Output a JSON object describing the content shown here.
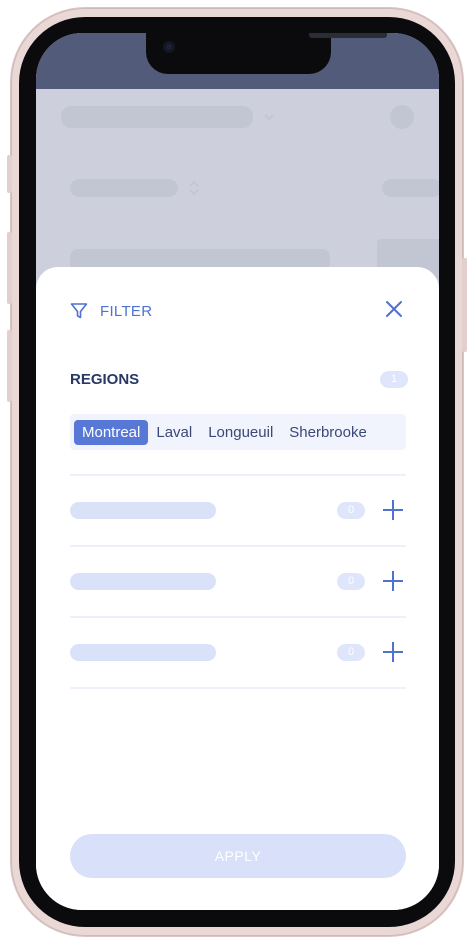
{
  "colors": {
    "accent": "#5778d7",
    "accent_text": "#4f71cf",
    "title_text": "#2a3866",
    "pill_bg": "#dfe5fa",
    "apply_disabled_bg": "#d8e0fa"
  },
  "filter": {
    "title": "FILTER",
    "icon": "funnel-icon",
    "close_icon": "close-icon"
  },
  "regions": {
    "title": "REGIONS",
    "selected_count": "1",
    "tabs": [
      {
        "label": "Montreal",
        "selected": true
      },
      {
        "label": "Laval",
        "selected": false
      },
      {
        "label": "Longueuil",
        "selected": false
      },
      {
        "label": "Sherbrooke",
        "selected": false
      }
    ]
  },
  "rows": [
    {
      "count": "0",
      "icon": "plus-icon"
    },
    {
      "count": "0",
      "icon": "plus-icon"
    },
    {
      "count": "0",
      "icon": "plus-icon"
    }
  ],
  "apply_label": "APPLY"
}
